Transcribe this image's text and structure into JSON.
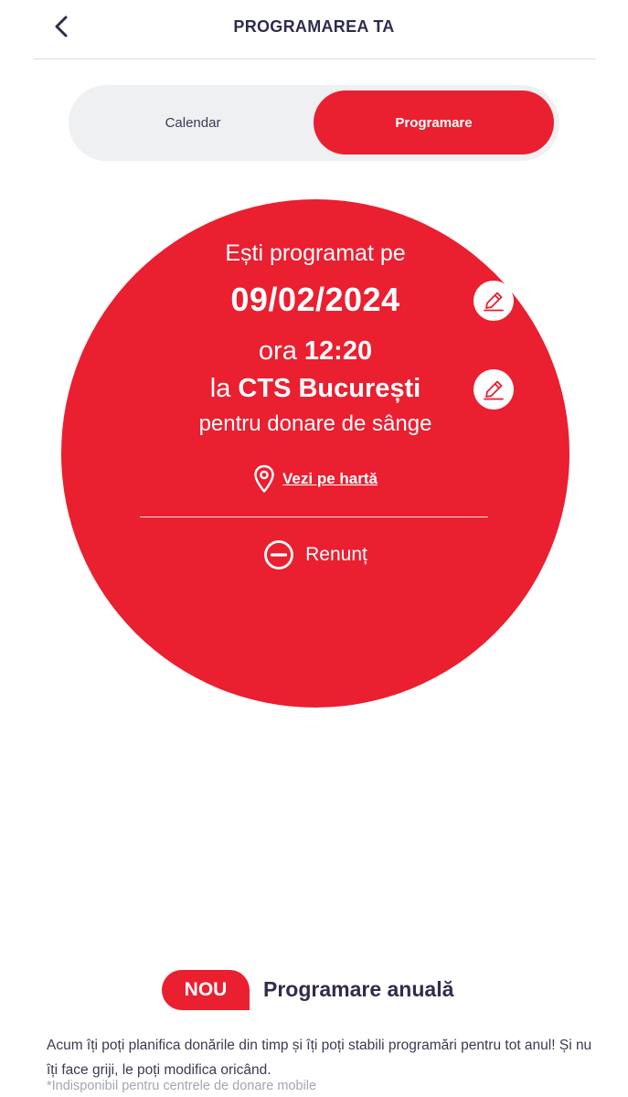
{
  "header": {
    "title": "PROGRAMAREA TA",
    "back_icon": "chevron-left-icon"
  },
  "tabs": [
    {
      "label": "Calendar",
      "active": false
    },
    {
      "label": "Programare",
      "active": true
    }
  ],
  "appointment": {
    "intro": "Ești programat pe",
    "date": "09/02/2024",
    "time_prefix": "ora",
    "time": "12:20",
    "place_prefix": "la",
    "place": "CTS București",
    "purpose": "pentru donare de sânge",
    "map_link": "Vezi pe hartă",
    "cancel": "Renunț",
    "edit_icon": "pencil-icon",
    "map_icon": "map-pin-icon",
    "cancel_icon": "minus-circle-icon"
  },
  "promo": {
    "badge": "NOU",
    "title": "Programare anuală",
    "text": "Acum îți poți planifica donările din timp și îți poți stabili programări pentru tot anul! Și nu îți face griji, le poți modifica oricând.",
    "note": "*Indisponibil pentru centrele de donare mobile"
  },
  "colors": {
    "accent": "#ea1f30",
    "text": "#2e2d4d",
    "segment_bg": "#eff0f2",
    "muted": "#a2a6b4"
  }
}
